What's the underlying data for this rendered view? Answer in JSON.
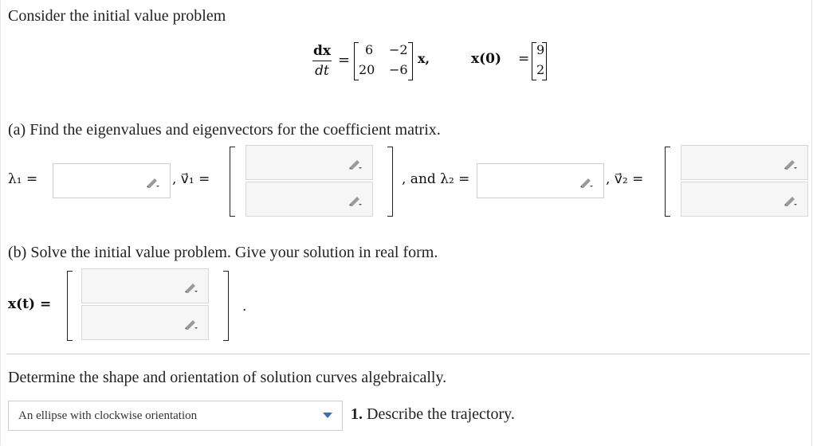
{
  "intro": "Consider the initial value problem",
  "equation": {
    "lhs_num": "dx",
    "lhs_den": "dt",
    "equals": "=",
    "matrix": [
      [
        "6",
        "−2"
      ],
      [
        "20",
        "−6"
      ]
    ],
    "x_label": "x,",
    "ic_label": "x(0)",
    "ic_equals": "=",
    "ic_vector": [
      "9",
      "2"
    ]
  },
  "part_a": {
    "prompt": "(a) Find the eigenvalues and eigenvectors for the coefficient matrix.",
    "lambda1_label": "λ₁ =",
    "v1_label": ", v⃗₁ =",
    "and_lambda2_label": ", and λ₂ =",
    "v2_label": ", v⃗₂ =",
    "lambda1_value": "",
    "v1_values": [
      "",
      ""
    ],
    "lambda2_value": "",
    "v2_values": [
      "",
      ""
    ]
  },
  "part_b": {
    "prompt": "(b) Solve the initial value problem. Give your solution in real form.",
    "x_label": "x(t) =",
    "x_values": [
      "",
      ""
    ],
    "period": "."
  },
  "shape": {
    "prompt": "Determine the shape and orientation of solution curves algebraically.",
    "select_value": "An ellipse with clockwise orientation",
    "question": "1. Describe the trajectory."
  },
  "icons": {
    "pencil": "pencil-icon",
    "dropdown": "chevron-down-icon"
  },
  "colors": {
    "caret": "#3a6fb0",
    "input_border": "#cfcfcf",
    "input_grey_bg": "#f6f6f6"
  }
}
